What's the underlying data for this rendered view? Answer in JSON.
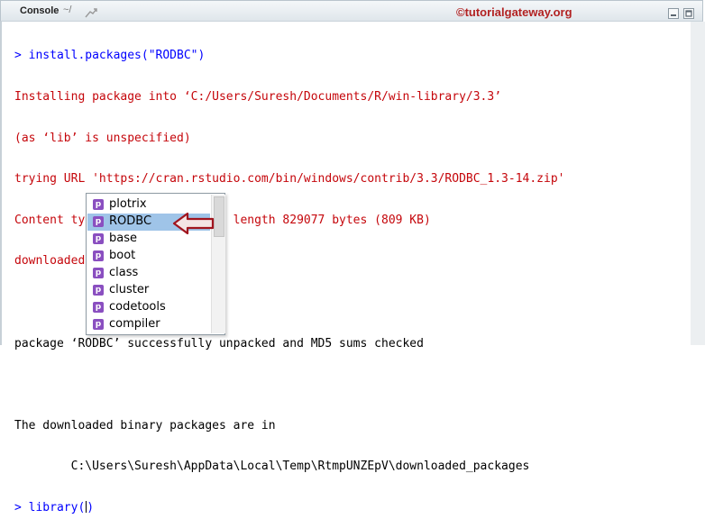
{
  "header": {
    "title": "Console",
    "path": "~/",
    "watermark": "©tutorialgateway.org"
  },
  "console": {
    "lines": [
      {
        "text": "> install.packages(\"RODBC\")",
        "kind": "cmd"
      },
      {
        "text": "Installing package into ‘C:/Users/Suresh/Documents/R/win-library/3.3’",
        "kind": "err"
      },
      {
        "text": "(as ‘lib’ is unspecified)",
        "kind": "err"
      },
      {
        "text": "trying URL 'https://cran.rstudio.com/bin/windows/contrib/3.3/RODBC_1.3-14.zip'",
        "kind": "err"
      },
      {
        "text": "Content type 'application/zip' length 829077 bytes (809 KB)",
        "kind": "err"
      },
      {
        "text": "downloaded 809 KB",
        "kind": "err"
      },
      {
        "text": "",
        "kind": "out"
      },
      {
        "text": "package ‘RODBC’ successfully unpacked and MD5 sums checked",
        "kind": "out"
      },
      {
        "text": "",
        "kind": "out"
      },
      {
        "text": "The downloaded binary packages are in",
        "kind": "out"
      },
      {
        "text": "        C:\\Users\\Suresh\\AppData\\Local\\Temp\\RtmpUNZEpV\\downloaded_packages",
        "kind": "out"
      }
    ],
    "prompt_input": "> library()"
  },
  "autocomplete": {
    "icon_letter": "p",
    "selected": "RODBC",
    "items": [
      "plotrix",
      "RODBC",
      "base",
      "boot",
      "class",
      "cluster",
      "codetools",
      "compiler"
    ]
  },
  "colors": {
    "command": "#0000ff",
    "message": "#c5060b",
    "selection": "#9fc4e8",
    "package_icon": "#8a4fc0",
    "arrow": "#a0141e"
  }
}
